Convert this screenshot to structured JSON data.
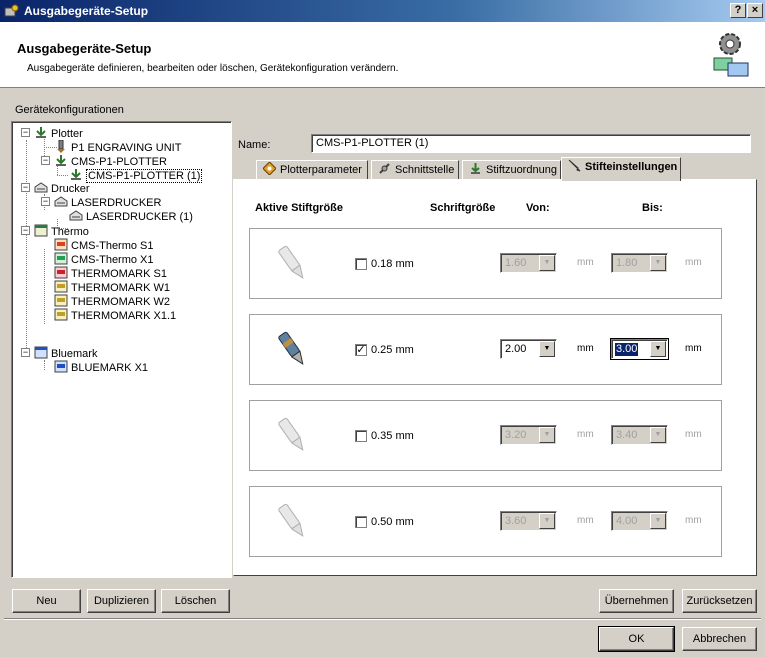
{
  "window": {
    "title": "Ausgabegeräte-Setup",
    "help_label": "?",
    "close_label": "×"
  },
  "header": {
    "title": "Ausgabegeräte-Setup",
    "subtitle": "Ausgabegeräte definieren, bearbeiten oder löschen, Gerätekonfiguration verändern."
  },
  "tree": {
    "label": "Gerätekonfigurationen",
    "nodes": [
      {
        "label": "Plotter",
        "icon": "plotter-icon"
      },
      {
        "label": "P1 ENGRAVING UNIT",
        "icon": "engraving-unit-icon"
      },
      {
        "label": "CMS-P1-PLOTTER",
        "icon": "plotter-icon"
      },
      {
        "label": "CMS-P1-PLOTTER (1)",
        "icon": "plotter-icon",
        "selected": true
      },
      {
        "label": "Drucker",
        "icon": "printer-icon"
      },
      {
        "label": "LASERDRUCKER",
        "icon": "printer-icon"
      },
      {
        "label": "LASERDRUCKER (1)",
        "icon": "printer-icon"
      },
      {
        "label": "Thermo",
        "icon": "thermo-icon"
      },
      {
        "label": "CMS-Thermo S1",
        "icon": "thermo-device-icon"
      },
      {
        "label": "CMS-Thermo X1",
        "icon": "thermo-device-icon"
      },
      {
        "label": "THERMOMARK S1",
        "icon": "thermo-device-icon"
      },
      {
        "label": "THERMOMARK W1",
        "icon": "thermo-device-icon"
      },
      {
        "label": "THERMOMARK W2",
        "icon": "thermo-device-icon"
      },
      {
        "label": "THERMOMARK X1.1",
        "icon": "thermo-device-icon"
      },
      {
        "label": "Bluemark",
        "icon": "bluemark-icon"
      },
      {
        "label": "BLUEMARK X1",
        "icon": "bluemark-device-icon"
      }
    ]
  },
  "tree_buttons": {
    "new": "Neu",
    "duplicate": "Duplizieren",
    "delete": "Löschen"
  },
  "name": {
    "label": "Name:",
    "value": "CMS-P1-PLOTTER (1)"
  },
  "tabs": [
    {
      "label": "Plotterparameter",
      "icon": "plotter-parameter-icon"
    },
    {
      "label": "Schnittstelle",
      "icon": "interface-icon"
    },
    {
      "label": "Stiftzuordnung",
      "icon": "pen-assignment-icon"
    },
    {
      "label": "Stifteinstellungen",
      "icon": "pen-settings-icon",
      "active": true
    }
  ],
  "columns": {
    "active_pen": "Aktive Stiftgröße",
    "font_size": "Schriftgröße",
    "from": "Von:",
    "to": "Bis:"
  },
  "unit": "mm",
  "pens": [
    {
      "size": "0.18 mm",
      "checked": false,
      "from": "1.60",
      "to": "1.80"
    },
    {
      "size": "0.25 mm",
      "checked": true,
      "from": "2.00",
      "to": "3.00"
    },
    {
      "size": "0.35 mm",
      "checked": false,
      "from": "3.20",
      "to": "3.40"
    },
    {
      "size": "0.50 mm",
      "checked": false,
      "from": "3.60",
      "to": "4.00"
    }
  ],
  "footer": {
    "apply": "Übernehmen",
    "reset": "Zurücksetzen",
    "ok": "OK",
    "cancel": "Abbrechen"
  },
  "colors": {
    "title_bar": "#0a246a",
    "selection": "#0a246a",
    "dialog_bg": "#d4d0c8"
  }
}
